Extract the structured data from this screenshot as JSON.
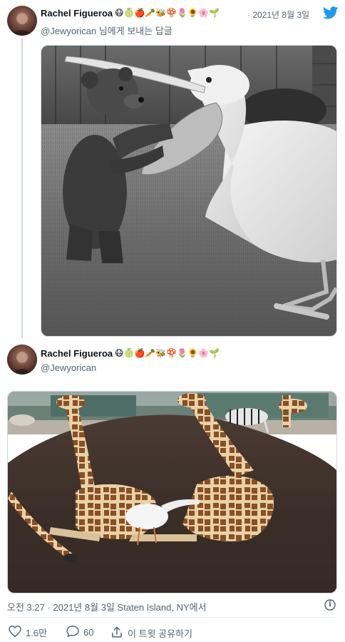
{
  "tweet1": {
    "author_name": "Rachel Figueroa",
    "author_emojis": "😷🍈🍎🥕🐝🍄🌷🌻🌸🌱",
    "date": "· 2021년 8월 3일",
    "reply_to": "@Jewyorican 님에게 보내는 답글"
  },
  "tweet2": {
    "author_name": "Rachel Figueroa",
    "author_emojis": "😷🍈🍎🥕🐝🍄🌷🌻🌸🌱",
    "handle": "@Jewyorican"
  },
  "footer": {
    "timestamp": "오전 3:27 · 2021년 8월 3일 Staten Island, NY에서",
    "info_glyph": "i",
    "likes": "1.6만",
    "replies": "60",
    "share_label": "이 트윗 공유하기"
  },
  "colors": {
    "twitter_blue": "#1d9bf0",
    "text_secondary": "#536471"
  }
}
